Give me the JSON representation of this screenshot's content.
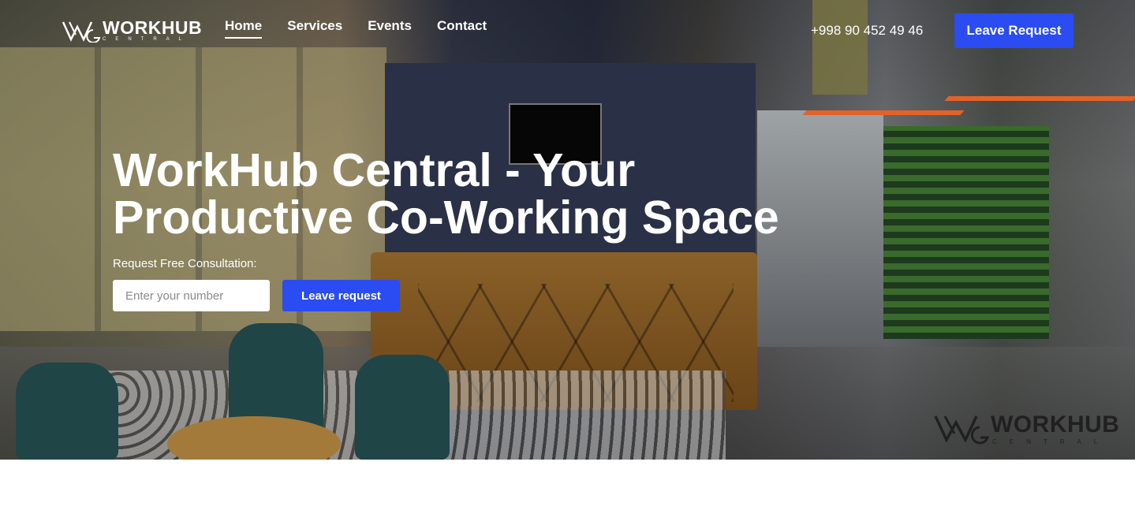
{
  "header": {
    "logo": {
      "name": "WORKHUB",
      "sub": "CENTRAL"
    },
    "nav": [
      {
        "label": "Home",
        "active": true
      },
      {
        "label": "Services",
        "active": false
      },
      {
        "label": "Events",
        "active": false
      },
      {
        "label": "Contact",
        "active": false
      }
    ],
    "phone": "+998 90 452 49 46",
    "cta_label": "Leave Request"
  },
  "hero": {
    "title_line1": "WorkHub Central - Your",
    "title_line2": "Productive Co-Working Space",
    "consult_label": "Request Free Consultation:",
    "input_placeholder": "Enter your number",
    "submit_label": "Leave request"
  },
  "watermark": {
    "name": "WORKHUB",
    "sub": "CENTRAL"
  },
  "colors": {
    "accent": "#2a4cf0",
    "text_on_hero": "#ffffff"
  }
}
